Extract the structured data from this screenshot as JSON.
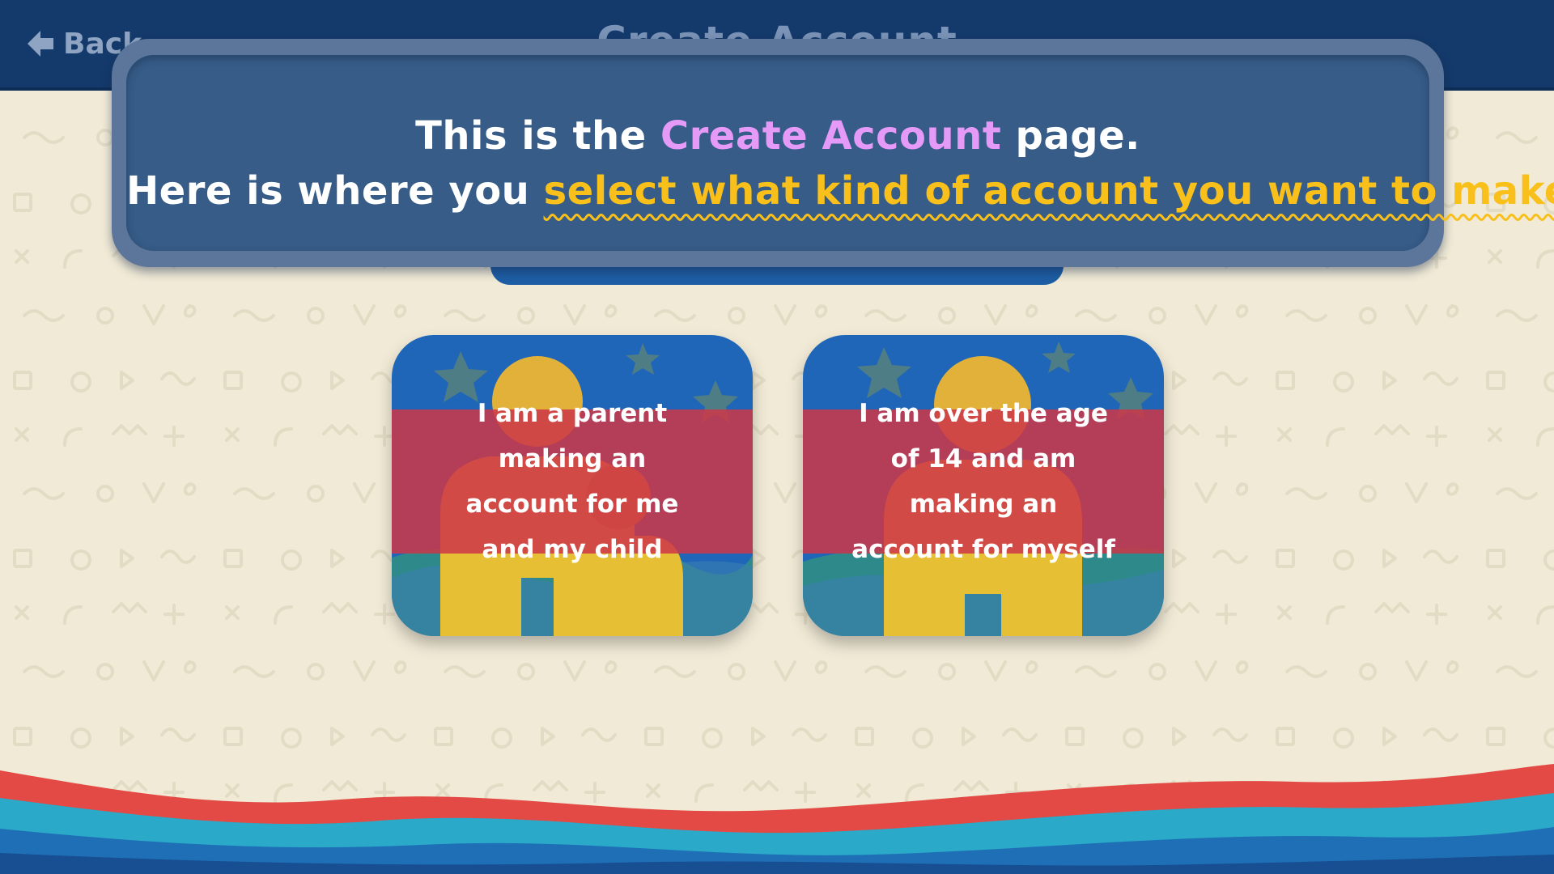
{
  "header": {
    "back_label": "Back",
    "title": "Create Account"
  },
  "tutorial": {
    "line1": {
      "before": "This is the ",
      "highlight": "Create Account",
      "after": " page."
    },
    "line2": {
      "before": "Here is where you ",
      "highlight": "select what kind of account you want to make."
    }
  },
  "options": [
    {
      "label": "I am a parent making an account for me and my child",
      "icon": "parent-child-figures"
    },
    {
      "label": "I am over the age of 14 and am making an account for myself",
      "icon": "single-figure"
    }
  ],
  "colors": {
    "header_bg": "#143a6b",
    "page_bg": "#f1ead6",
    "tutorial_bg": "#365c87",
    "highlight_purple": "#e59af7",
    "highlight_yellow": "#f9c01b",
    "card_band": "#cd3748",
    "figure_yellow": "#f0c42a"
  }
}
